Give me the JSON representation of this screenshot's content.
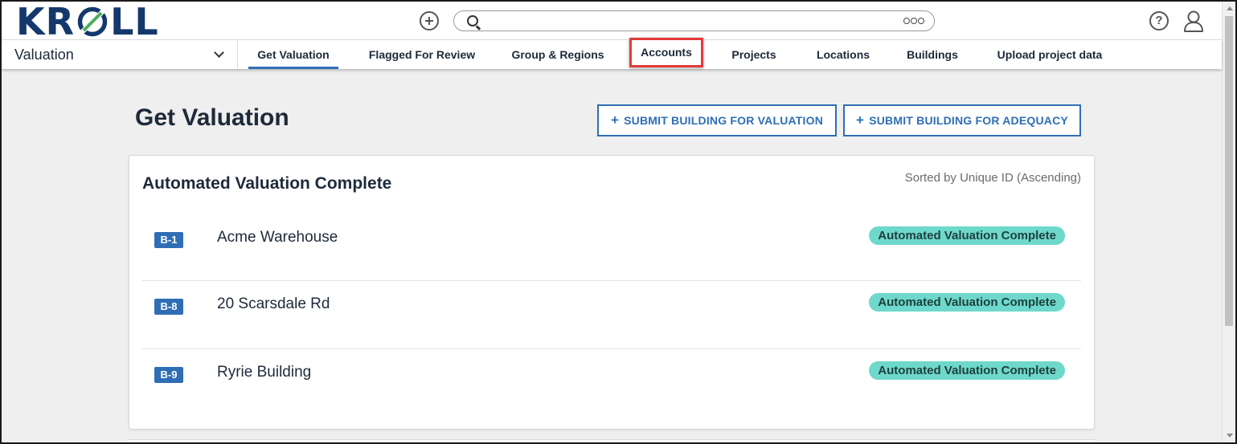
{
  "brand": {
    "logo_text_left": "KR",
    "logo_text_right": "LL",
    "primary_color": "#14386b",
    "accent_color": "#4bae5b"
  },
  "topbar": {
    "add_icon": "plus-circle-icon",
    "search_placeholder": "",
    "search_options_icon": "more-options-icon",
    "help_icon_glyph": "?",
    "user_icon": "user-icon"
  },
  "nav": {
    "module_label": "Valuation",
    "tabs": [
      {
        "label": "Get Valuation"
      },
      {
        "label": "Flagged For Review"
      },
      {
        "label": "Group & Regions"
      },
      {
        "label": "Accounts"
      },
      {
        "label": "Projects"
      },
      {
        "label": "Locations"
      },
      {
        "label": "Buildings"
      },
      {
        "label": "Upload project data"
      }
    ],
    "active_color": "#2f6eb5",
    "highlight_color": "#e23b3b"
  },
  "main": {
    "title": "Get Valuation",
    "actions": {
      "submit_valuation_label": "SUBMIT BUILDING FOR VALUATION",
      "submit_adequacy_label": "SUBMIT BUILDING FOR ADEQUACY",
      "plus_glyph": "+"
    },
    "card": {
      "title": "Automated Valuation Complete",
      "sort_label": "Sorted by Unique ID (Ascending)",
      "rows": [
        {
          "id": "B-1",
          "name": "Acme Warehouse",
          "status": "Automated Valuation Complete"
        },
        {
          "id": "B-8",
          "name": "20 Scarsdale Rd",
          "status": "Automated Valuation Complete"
        },
        {
          "id": "B-9",
          "name": "Ryrie Building",
          "status": "Automated Valuation Complete"
        }
      ],
      "status_color": "#6ed8cb",
      "id_badge_color": "#2f6eb5"
    }
  }
}
